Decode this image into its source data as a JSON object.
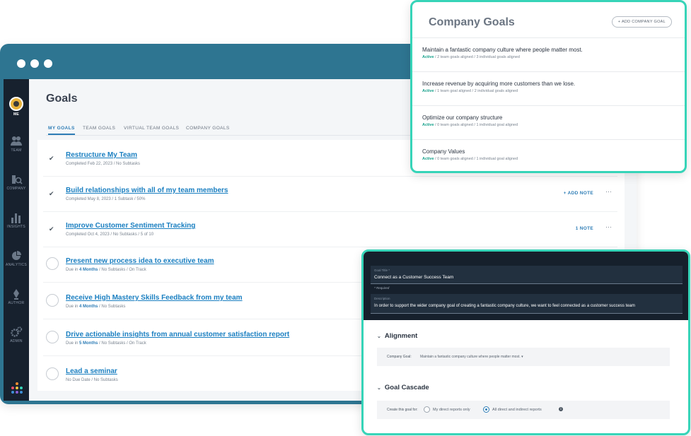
{
  "sidebar": {
    "items": [
      {
        "label": "ME",
        "icon": "user-avatar"
      },
      {
        "label": "TEAM",
        "icon": "team-icon"
      },
      {
        "label": "COMPANY",
        "icon": "company-search-icon"
      },
      {
        "label": "INSIGHTS",
        "icon": "bar-chart-icon"
      },
      {
        "label": "ANALYTICS",
        "icon": "pie-chart-icon"
      },
      {
        "label": "AUTHOR",
        "icon": "pen-nib-icon"
      },
      {
        "label": "ADMIN",
        "icon": "gears-icon"
      }
    ]
  },
  "main": {
    "title": "Goals",
    "tabs": [
      "MY GOALS",
      "TEAM GOALS",
      "VIRTUAL TEAM GOALS",
      "COMPANY GOALS"
    ],
    "goals": [
      {
        "title": "Restructure My Team",
        "meta": "Completed Feb 22, 2023  /  No Subtasks",
        "done": true,
        "action": ""
      },
      {
        "title": "Build relationships with all of my team members",
        "meta": "Completed May 8, 2023  /  1 Subtask  /  50%",
        "done": true,
        "action": "+ ADD NOTE"
      },
      {
        "title": "Improve Customer Sentiment Tracking",
        "meta": "Completed Oct 4, 2023  /  No Subtasks  /  5 of 10",
        "done": true,
        "action": "1 NOTE"
      },
      {
        "title": "Present new process idea to executive team",
        "meta_prefix": "Due in ",
        "meta_due": "4 Months",
        "meta_suffix": "  /  No Subtasks  /  On Track",
        "done": false
      },
      {
        "title": "Receive High Mastery Skills Feedback from my team",
        "meta_prefix": "Due in ",
        "meta_due": "4 Months",
        "meta_suffix": "  /  No Subtasks",
        "done": false
      },
      {
        "title": "Drive actionable insights from annual customer satisfaction report",
        "meta_prefix": "Due in ",
        "meta_due": "5 Months",
        "meta_suffix": "  /  No Subtasks  /  On Track",
        "done": false
      },
      {
        "title": "Lead a seminar",
        "meta": "No Due Date  /  No Subtasks",
        "done": false
      }
    ],
    "more_glyph": "···"
  },
  "company_goals": {
    "title": "Company Goals",
    "add_button": "+ ADD COMPANY GOAL",
    "items": [
      {
        "name": "Maintain a fantastic company culture where people matter most.",
        "status": "Active",
        "detail": " / 2 team goals aligned / 3 individual goals aligned"
      },
      {
        "name": "Increase revenue by acquiring more customers than we lose.",
        "status": "Active",
        "detail": " / 1 team goal aligned / 2 individual goals aligned"
      },
      {
        "name": "Optimize our company structure",
        "status": "Active",
        "detail": " / 0 team goals aligned / 1 individual goal aligned"
      },
      {
        "name": "Company Values",
        "status": "Active",
        "detail": " / 0 team goals aligned / 1 individual goal aligned"
      }
    ]
  },
  "goal_form": {
    "title_label": "Goal Title *",
    "title_value": "Connect as a Customer Success Team",
    "required_note": "* Required",
    "description_label": "Description",
    "description_value": "In order to support the wider company goal of creating a fantastic company culture, we want to feel connected as a customer success team",
    "alignment_heading": "Alignment",
    "company_goal_label": "Company Goal:",
    "company_goal_value": "Maintain a fantastic company culture where people matter most.  ▾",
    "cascade_heading": "Goal Cascade",
    "cascade_label": "Create this goal for:",
    "cascade_options": [
      "My direct reports only",
      "All direct and indirect reports"
    ],
    "cascade_selected": 1
  },
  "colors": {
    "window_frame": "#2e7591",
    "sidebar": "#17212e",
    "accent": "#2e7db6",
    "highlight_border": "#36d4b8",
    "active_status": "#15a08a"
  }
}
